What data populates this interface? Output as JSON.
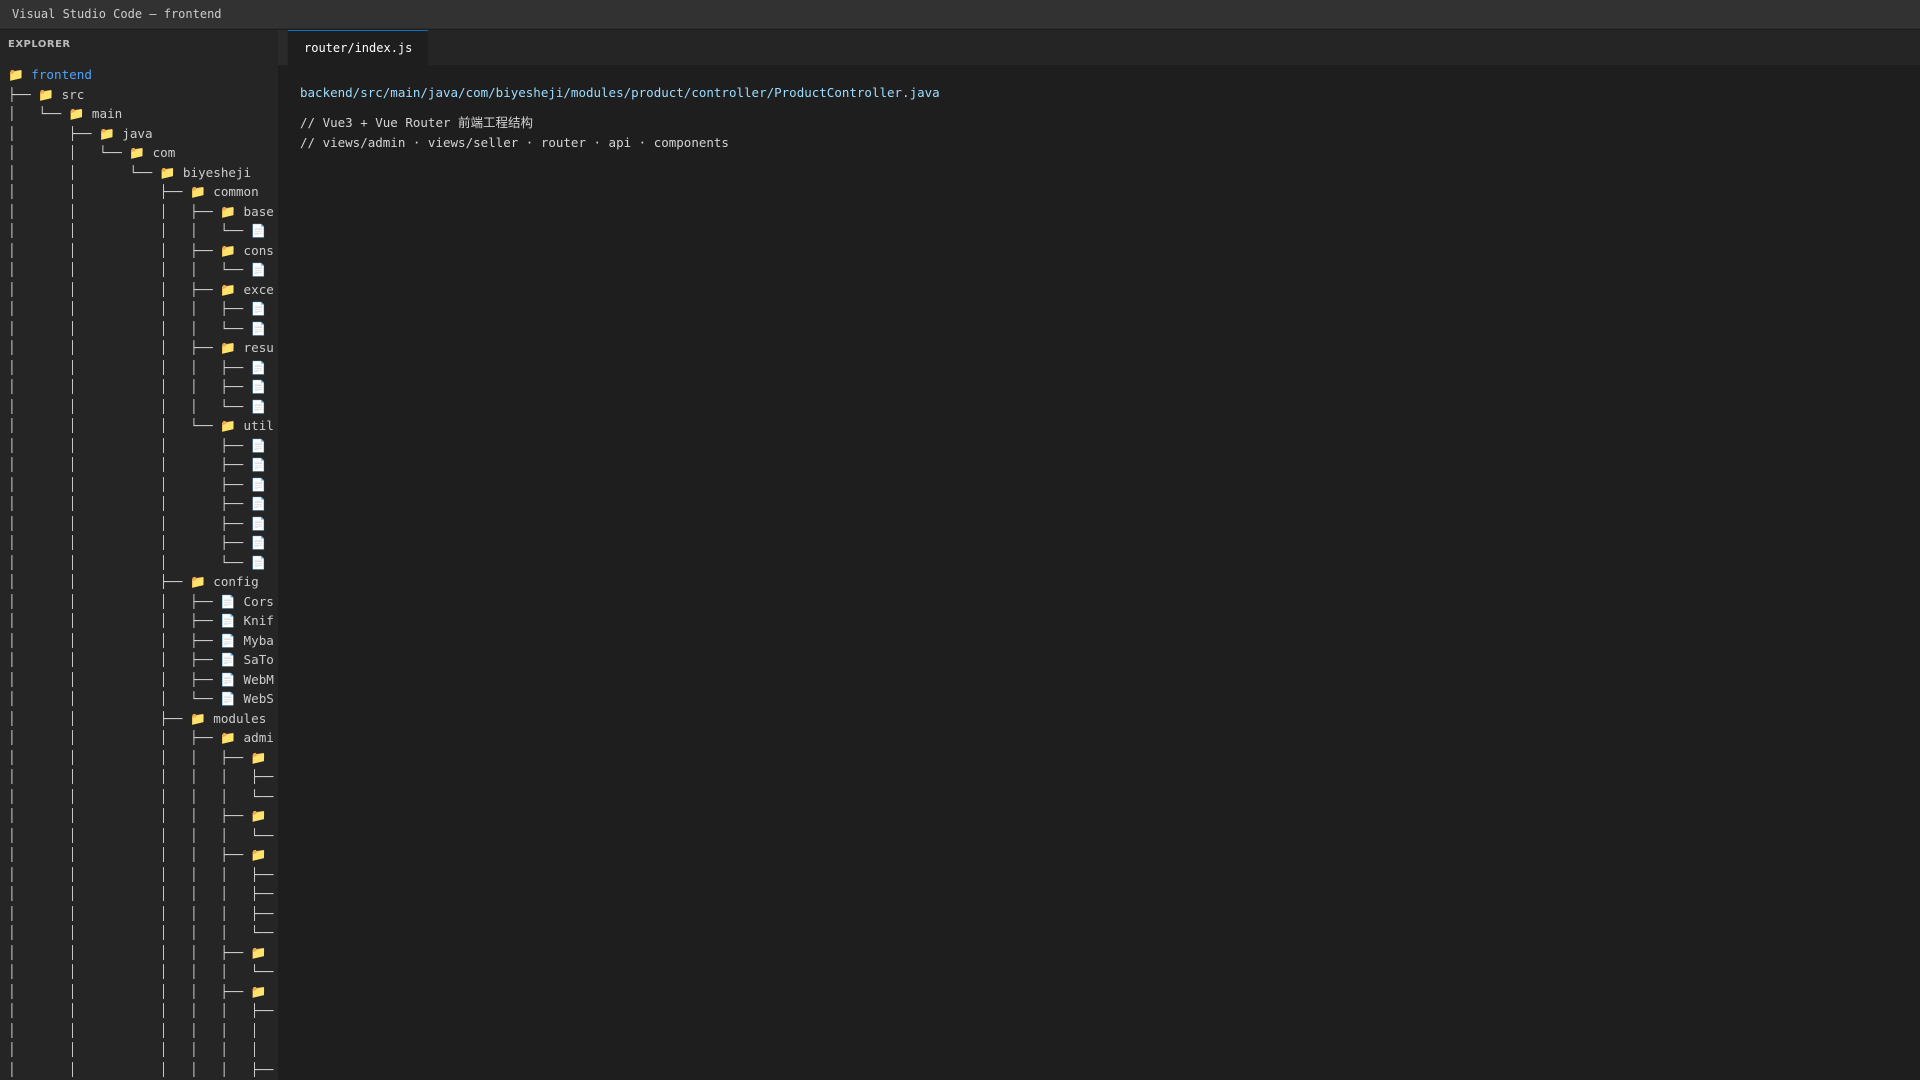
{
  "window": {
    "title": "Visual Studio Code — frontend"
  },
  "sidebar": {
    "header": "EXPLORER",
    "tree_lines": [
      "📁 frontend",
      "├── 📁 src",
      "│   └── 📁 main",
      "│       ├── 📁 java",
      "│       │   └── 📁 com",
      "│       │       └── 📁 biyesheji",
      "│       │           ├── 📁 common",
      "│       │           │   ├── 📁 base",
      "│       │           │   │   └── 📄",
      "│       │           │   ├── 📁 cons",
      "│       │           │   │   └── 📄",
      "│       │           │   ├── 📁 exce",
      "│       │           │   │   ├── 📄",
      "│       │           │   │   └── 📄",
      "│       │           │   ├── 📁 resu",
      "│       │           │   │   ├── 📄",
      "│       │           │   │   ├── 📄",
      "│       │           │   │   └── 📄",
      "│       │           │   └── 📁 util",
      "│       │           │       ├── 📄",
      "│       │           │       ├── 📄",
      "│       │           │       ├── 📄",
      "│       │           │       ├── 📄",
      "│       │           │       ├── 📄",
      "│       │           │       ├── 📄",
      "│       │           │       └── 📄",
      "│       │           ├── 📁 config",
      "│       │           │   ├── 📄 Cors",
      "│       │           │   ├── 📄 Knif",
      "│       │           │   ├── 📄 Myba",
      "│       │           │   ├── 📄 SaTo",
      "│       │           │   ├── 📄 WebM",
      "│       │           │   └── 📄 WebS",
      "│       │           ├── 📁 modules",
      "│       │           │   ├── 📁 admi",
      "│       │           │   │   ├── 📁",
      "│       │           │   │   │   ├──",
      "│       │           │   │   │   └──",
      "│       │           │   │   ├── 📁",
      "│       │           │   │   │   └──",
      "│       │           │   │   ├── 📁",
      "│       │           │   │   │   ├──",
      "│       │           │   │   │   ├──",
      "│       │           │   │   │   ├──",
      "│       │           │   │   │   └──",
      "│       │           │   │   ├── 📁",
      "│       │           │   │   │   └──",
      "│       │           │   │   ├── 📁",
      "│       │           │   │   │   ├──",
      "│       │           │   │   │   │",
      "│       │           │   │   │   │",
      "│       │           │   │   │   ├──"
    ]
  },
  "editor": {
    "tabs": [
      {
        "label": "router/index.js",
        "active": true
      }
    ],
    "path_line": "backend/src/main/java/com/biyesheji/modules/product/controller/ProductController.java",
    "code_lines": [
      "// Vue3 + Vue Router 前端工程结构",
      "// views/admin · views/seller · router · api · components"
    ]
  },
  "colors": {
    "titlebar_bg": "#323233",
    "sidebar_bg": "#252526",
    "editor_bg": "#1e1e1e",
    "root_folder": "#4fa3f7",
    "path_text": "#9cdcfe",
    "active_tab_border": "#0e70c0"
  }
}
